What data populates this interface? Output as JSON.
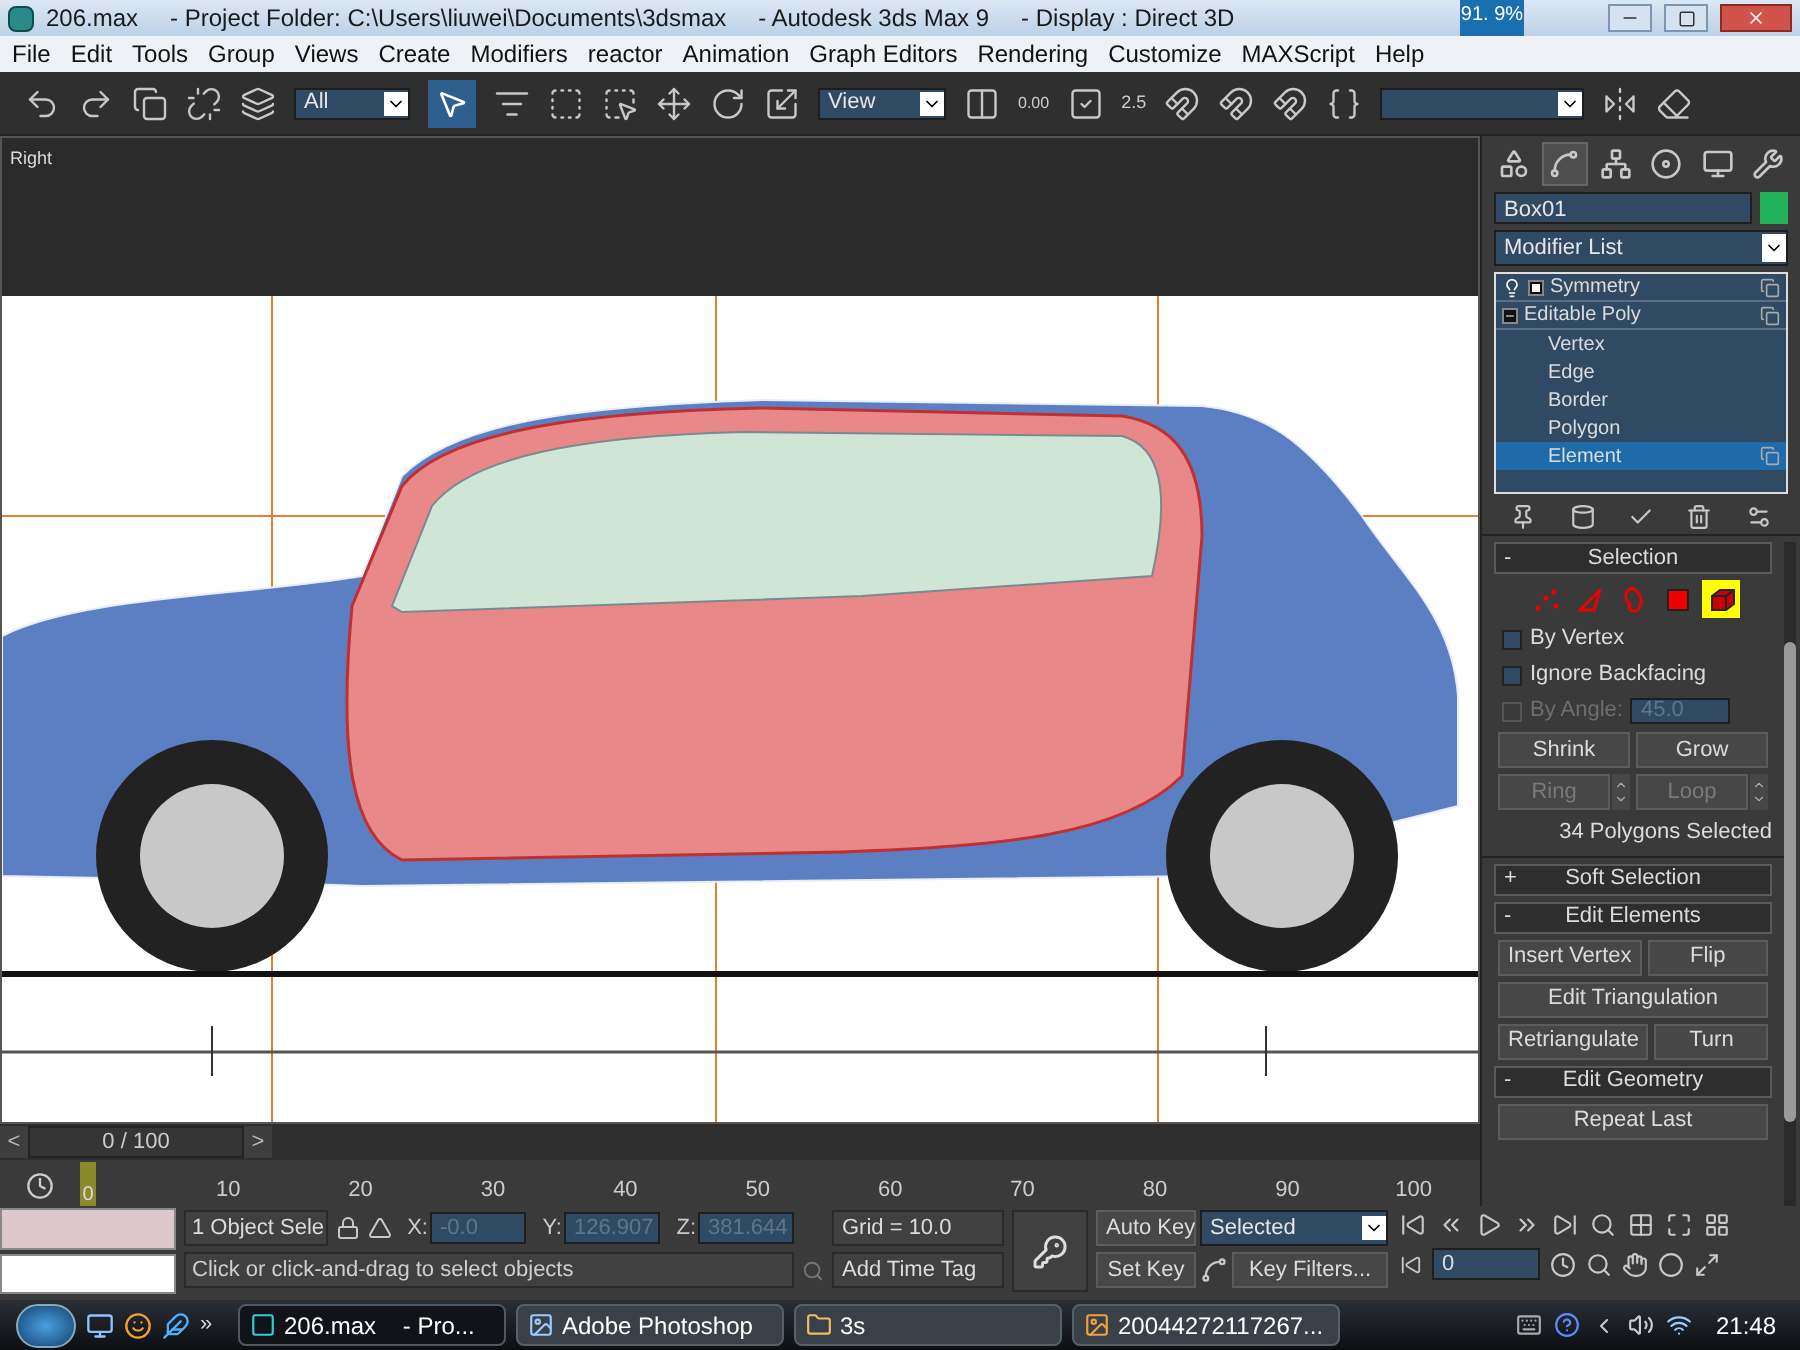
{
  "window": {
    "title_parts": [
      "206.max",
      "- Project Folder: C:\\Users\\liuwei\\Documents\\3dsmax",
      "- Autodesk 3ds Max 9",
      "- Display : Direct 3D"
    ],
    "cpu_meter": "91. 9%"
  },
  "menu": [
    "File",
    "Edit",
    "Tools",
    "Group",
    "Views",
    "Create",
    "Modifiers",
    "reactor",
    "Animation",
    "Graph Editors",
    "Rendering",
    "Customize",
    "MAXScript",
    "Help"
  ],
  "toolbar": {
    "selection_filter": "All",
    "select_object_active": true,
    "reference_coordinate_system": "View",
    "spinner_snap": "0.00",
    "angle_snap": "2.5"
  },
  "viewport": {
    "label": "Right"
  },
  "command_panel": {
    "tabs": [
      {
        "kind": "create",
        "selected": false
      },
      {
        "kind": "modify",
        "selected": true
      },
      {
        "kind": "hierarchy",
        "selected": false
      },
      {
        "kind": "motion",
        "selected": false
      },
      {
        "kind": "display",
        "selected": false
      },
      {
        "kind": "utilities",
        "selected": false
      }
    ],
    "object_name": "Box01",
    "modifier_list": "Modifier List",
    "stack": [
      {
        "label": "Symmetry",
        "expanded": false,
        "selected": false
      },
      {
        "label": "Editable Poly",
        "expanded": true,
        "selected": false,
        "children": [
          {
            "label": "Vertex",
            "selected": false
          },
          {
            "label": "Edge",
            "selected": false
          },
          {
            "label": "Border",
            "selected": false
          },
          {
            "label": "Polygon",
            "selected": false
          },
          {
            "label": "Element",
            "selected": true
          }
        ]
      }
    ],
    "selection_rollout": {
      "sign": "-",
      "title": "Selection",
      "levels": [
        {
          "kind": "vertex",
          "selected": false
        },
        {
          "kind": "edge",
          "selected": false
        },
        {
          "kind": "border",
          "selected": false
        },
        {
          "kind": "polygon",
          "selected": false
        },
        {
          "kind": "element",
          "selected": true
        }
      ],
      "checkboxes": [
        {
          "label": "By Vertex",
          "checked": false,
          "disabled": false
        },
        {
          "label": "Ignore Backfacing",
          "checked": false,
          "disabled": false
        },
        {
          "label": "By Angle:",
          "checked": false,
          "disabled": true,
          "value": "45.0"
        }
      ],
      "buttons": [
        {
          "label": "Shrink",
          "disabled": false,
          "spinner": false
        },
        {
          "label": "Grow",
          "disabled": false,
          "spinner": false
        },
        {
          "label": "Ring",
          "disabled": true,
          "spinner": true
        },
        {
          "label": "Loop",
          "disabled": true,
          "spinner": true
        }
      ],
      "status": "34 Polygons Selected"
    },
    "soft_selection_rollout": {
      "sign": "+",
      "title": "Soft Selection"
    },
    "edit_elements_rollout": {
      "sign": "-",
      "title": "Edit Elements",
      "button_rows": [
        [
          "Insert Vertex",
          "Flip"
        ],
        [
          "Edit Triangulation"
        ],
        [
          "Retriangulate",
          "Turn"
        ]
      ]
    },
    "edit_geometry_rollout": {
      "sign": "-",
      "title": "Edit Geometry",
      "buttons": [
        "Repeat Last"
      ]
    }
  },
  "time_slider": {
    "prev": "<",
    "position": "0 / 100",
    "next": ">",
    "level": 0
  },
  "track_bar": {
    "current_frame": "0",
    "ticks": [
      "10",
      "20",
      "30",
      "40",
      "50",
      "60",
      "70",
      "80",
      "90",
      "100"
    ]
  },
  "status_bar": {
    "selection": "1 Object Sele",
    "coordinates": [
      {
        "axis": "X:",
        "value": "-0.0"
      },
      {
        "axis": "Y:",
        "value": "126.907"
      },
      {
        "axis": "Z:",
        "value": "381.644"
      }
    ],
    "grid": "Grid = 10.0",
    "prompt": "Click or click-and-drag to select objects",
    "time_tag": "Add Time Tag"
  },
  "animation": {
    "auto_key": "Auto Key",
    "set_key": "Set Key",
    "key_mode": "Selected",
    "key_filters": "Key Filters...",
    "frame": "0"
  },
  "taskbar": {
    "overflow": "»",
    "tasks": [
      {
        "label": "206.max    - Pro...",
        "kind": "max",
        "selected": true
      },
      {
        "label": "Adobe Photoshop",
        "kind": "photoshop",
        "selected": false
      },
      {
        "label": "3s",
        "kind": "folder",
        "selected": false
      },
      {
        "label": "20044272117267...",
        "kind": "image",
        "selected": false
      }
    ],
    "clock": "21:48"
  }
}
